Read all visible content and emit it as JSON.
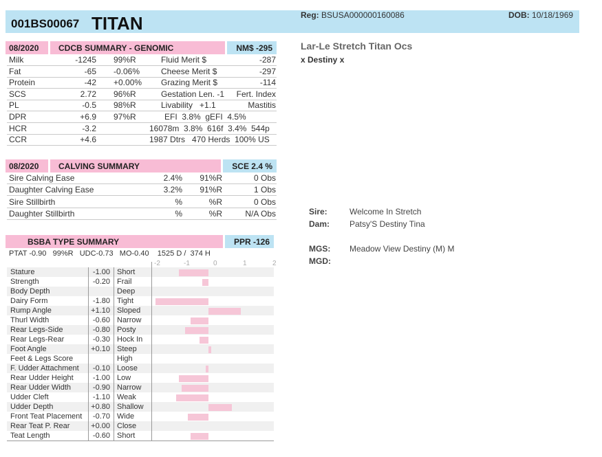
{
  "header": {
    "reg_id": "001BS00067",
    "name": "TITAN",
    "reg_label": "Reg:",
    "reg_value": "BSUSA000000160086",
    "dob_label": "DOB:",
    "dob_value": "10/18/1969"
  },
  "pedigree": {
    "full_name": "Lar-Le Stretch Titan Ocs",
    "cross": "x Destiny x",
    "sire_label": "Sire:",
    "sire": "Welcome In Stretch",
    "dam_label": "Dam:",
    "dam": "Patsy'S Destiny Tina",
    "mgs_label": "MGS:",
    "mgs": "Meadow View Destiny (M) M",
    "mgd_label": "MGD:",
    "mgd": ""
  },
  "genomic": {
    "date": "08/2020",
    "title": "CDCB SUMMARY - GENOMIC",
    "nm_label": "NM$ -295",
    "rows": [
      {
        "trait": "Milk",
        "value": "-1245",
        "rel": "99%R",
        "merit": "Fluid Merit $",
        "merit_val": "-287"
      },
      {
        "trait": "Fat",
        "value": "-65",
        "rel": "-0.06%",
        "merit": "Cheese Merit $",
        "merit_val": "-297"
      },
      {
        "trait": "Protein",
        "value": "-42",
        "rel": "+0.00%",
        "merit": "Grazing Merit $",
        "merit_val": "-114"
      },
      {
        "trait": "SCS",
        "value": "2.72",
        "rel": "96%R",
        "merit": "Gestation Len. -1",
        "merit_val": "Fert. Index"
      },
      {
        "trait": "PL",
        "value": "-0.5",
        "rel": "98%R",
        "merit": "Livability   +1.1",
        "merit_val": "Mastitis"
      },
      {
        "trait": "DPR",
        "value": "+6.9",
        "rel": "97%R",
        "merit": "EFI  3.8%  gEFI  4.5%",
        "merit_val": ""
      },
      {
        "trait": "HCR",
        "value": "-3.2",
        "rel": "",
        "merit": "16078m  3.8%  616f  3.4%  544p",
        "merit_val": ""
      },
      {
        "trait": "CCR",
        "value": "+4.6",
        "rel": "",
        "merit": "1987 Dtrs   470 Herds  100% US",
        "merit_val": ""
      }
    ]
  },
  "calving": {
    "date": "08/2020",
    "title": "CALVING SUMMARY",
    "sce_label": "SCE 2.4 %",
    "rows": [
      {
        "trait": "Sire Calving Ease",
        "pct": "2.4%",
        "rel": "91%R",
        "obs": "0 Obs"
      },
      {
        "trait": "Daughter Calving Ease",
        "pct": "3.2%",
        "rel": "91%R",
        "obs": "1 Obs"
      },
      {
        "trait": "Sire Stillbirth",
        "pct": "%",
        "rel": "%R",
        "obs": "0 Obs"
      },
      {
        "trait": "Daughter Stillbirth",
        "pct": "%",
        "rel": "%R",
        "obs": "N/A Obs"
      }
    ]
  },
  "type": {
    "title": "BSBA TYPE SUMMARY",
    "ppr_label": "PPR -126",
    "ptat_line": "PTAT -0.90   99%R   UDC-0.73   MO-0.40    1525 D /  374 H",
    "axis": [
      "-2",
      "-1",
      "0",
      "1",
      "2"
    ],
    "traits": [
      {
        "name": "Stature",
        "value": "-1.00",
        "desc": "Short",
        "score": -1.0
      },
      {
        "name": "Strength",
        "value": "-0.20",
        "desc": "Frail",
        "score": -0.2
      },
      {
        "name": "Body Depth",
        "value": "",
        "desc": "Deep",
        "score": 0
      },
      {
        "name": "Dairy Form",
        "value": "-1.80",
        "desc": "Tight",
        "score": -1.8
      },
      {
        "name": "Rump Angle",
        "value": "+1.10",
        "desc": "Sloped",
        "score": 1.1
      },
      {
        "name": "Thurl Width",
        "value": "-0.60",
        "desc": "Narrow",
        "score": -0.6
      },
      {
        "name": "Rear Legs-Side",
        "value": "-0.80",
        "desc": "Posty",
        "score": -0.8
      },
      {
        "name": "Rear Legs-Rear",
        "value": "-0.30",
        "desc": "Hock In",
        "score": -0.3
      },
      {
        "name": "Foot Angle",
        "value": "+0.10",
        "desc": "Steep",
        "score": 0.1
      },
      {
        "name": "Feet & Legs Score",
        "value": "",
        "desc": "High",
        "score": 0
      },
      {
        "name": "F. Udder Attachment",
        "value": "-0.10",
        "desc": "Loose",
        "score": -0.1
      },
      {
        "name": "Rear Udder Height",
        "value": "-1.00",
        "desc": "Low",
        "score": -1.0
      },
      {
        "name": "Rear Udder Width",
        "value": "-0.90",
        "desc": "Narrow",
        "score": -0.9
      },
      {
        "name": "Udder Cleft",
        "value": "-1.10",
        "desc": "Weak",
        "score": -1.1
      },
      {
        "name": "Udder Depth",
        "value": "+0.80",
        "desc": "Shallow",
        "score": 0.8
      },
      {
        "name": "Front Teat Placement",
        "value": "-0.70",
        "desc": "Wide",
        "score": -0.7
      },
      {
        "name": "Rear Teat P. Rear",
        "value": "+0.00",
        "desc": "Close",
        "score": 0
      },
      {
        "name": "Teat Length",
        "value": "-0.60",
        "desc": "Short",
        "score": -0.6
      }
    ]
  },
  "colors": {
    "pink": "#f8bcd5",
    "blue": "#bde3f3",
    "bar": "#f6c6d7"
  }
}
